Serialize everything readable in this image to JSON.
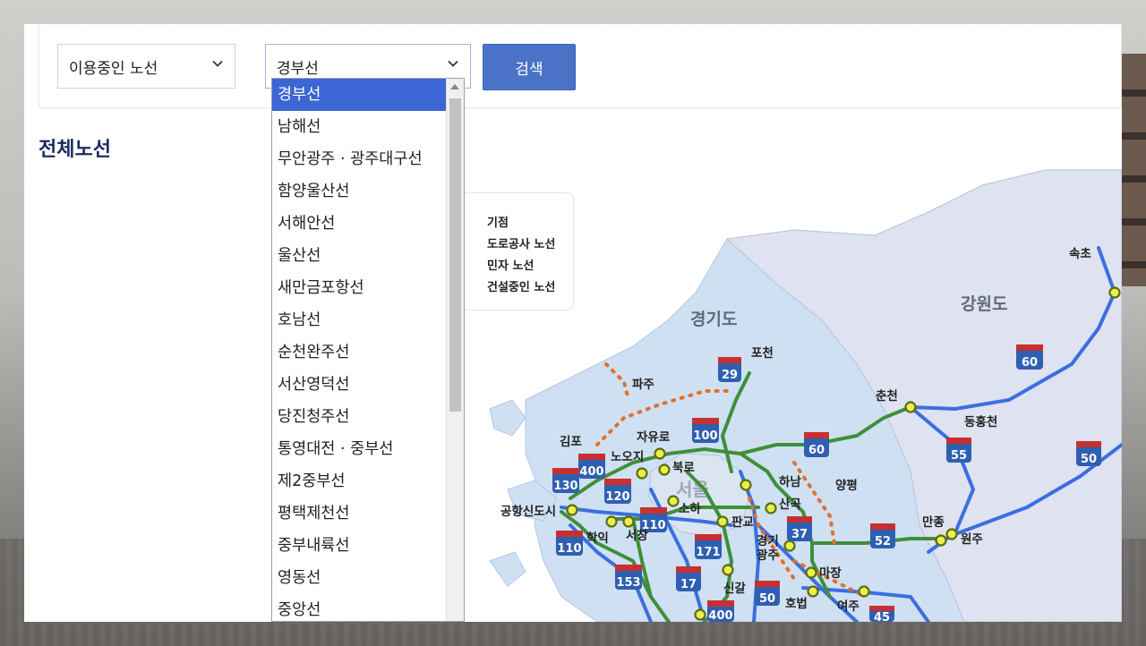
{
  "route_filter": {
    "selected": "이용중인 노선"
  },
  "route_select": {
    "selected": "경부선"
  },
  "search_button": {
    "label": "검색"
  },
  "section_title": "전체노선",
  "dropdown": {
    "options": [
      "경부선",
      "남해선",
      "무안광주 · 광주대구선",
      "함양울산선",
      "서해안선",
      "울산선",
      "새만금포항선",
      "호남선",
      "순천완주선",
      "서산영덕선",
      "당진청주선",
      "통영대전 · 중부선",
      "제2중부선",
      "평택제천선",
      "중부내륙선",
      "영동선",
      "중앙선"
    ],
    "selected_index": 0
  },
  "legend": {
    "items": [
      "기점",
      "도로공사 노선",
      "민자 노선",
      "건설중인 노선"
    ]
  },
  "map": {
    "regions": [
      "경기도",
      "강원도",
      "서울"
    ],
    "places": [
      "속초",
      "포천",
      "파주",
      "춘천",
      "동홍천",
      "자유로",
      "김포",
      "노오지",
      "북로",
      "하남",
      "양평",
      "공항신도시",
      "소하",
      "산곡",
      "학익",
      "서창",
      "판교",
      "만종",
      "원주",
      "경기광주",
      "마장",
      "신갈",
      "호법",
      "여주"
    ],
    "route_numbers": [
      "29",
      "60",
      "100",
      "60",
      "55",
      "50",
      "400",
      "130",
      "120",
      "110",
      "37",
      "52",
      "110",
      "171",
      "153",
      "17",
      "50",
      "400",
      "45"
    ]
  },
  "colors": {
    "accent": "#4a72c7",
    "selected_option": "#3b66d3",
    "title": "#1c2b5e",
    "expressway_green": "#3f8f3a",
    "route_blue": "#3a6fe0",
    "construction_dotted": "#e0702c",
    "province_gyeonggi": "#cfe0f3",
    "province_gangwon": "#dfe2f0"
  }
}
